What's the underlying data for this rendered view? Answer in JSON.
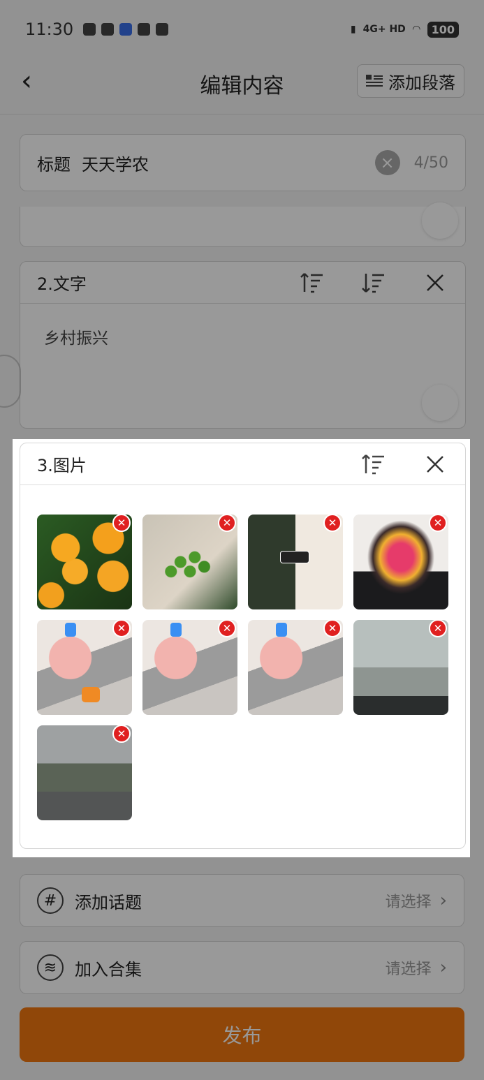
{
  "status": {
    "time": "11:30",
    "network": "4G+ HD",
    "battery": "100"
  },
  "nav": {
    "title": "编辑内容",
    "add_paragraph": "添加段落"
  },
  "title_field": {
    "label": "标题",
    "value": "天天学农",
    "count": "4/50"
  },
  "paragraph2": {
    "label": "2.文字",
    "text": "乡村振兴"
  },
  "paragraph3": {
    "label": "3.图片",
    "images": [
      "oranges",
      "green-fruits",
      "screenshot",
      "portrait",
      "app-screen-1",
      "app-screen-2",
      "app-screen-3",
      "rainy-road",
      "mountain-road"
    ]
  },
  "topic": {
    "label": "添加话题",
    "hint": "请选择"
  },
  "collection": {
    "label": "加入合集",
    "hint": "请选择"
  },
  "publish": {
    "label": "发布"
  },
  "colors": {
    "accent": "#f07710",
    "delete": "#e02020"
  }
}
